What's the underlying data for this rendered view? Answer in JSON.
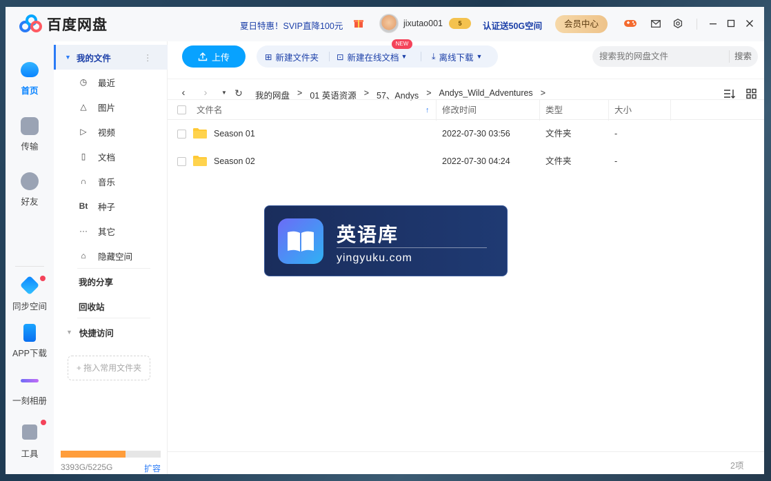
{
  "app": {
    "title": "百度网盘"
  },
  "titlebar": {
    "promo": "夏日特惠！SVIP直降100元",
    "username": "jixutao001",
    "level": "5",
    "verify": "认证送50G空间",
    "member": "会员中心"
  },
  "rail": {
    "home": "首页",
    "transfer": "传输",
    "friends": "好友",
    "sync": "同步空间",
    "app": "APP下载",
    "album": "一刻相册",
    "tools": "工具"
  },
  "sidebar": {
    "my_files": "我的文件",
    "items": [
      "最近",
      "图片",
      "视频",
      "文档",
      "音乐",
      "种子",
      "其它",
      "隐藏空间"
    ],
    "share": "我的分享",
    "recycle": "回收站",
    "quick": "快捷访问",
    "drag_hint": "+ 拖入常用文件夹",
    "quota_text": "3393G/5225G",
    "quota_fraction": 0.65,
    "expand": "扩容"
  },
  "toolbar": {
    "upload": "上传",
    "new_folder": "新建文件夹",
    "new_doc": "新建在线文档",
    "new_badge": "NEW",
    "offline": "离线下载",
    "search_placeholder": "搜索我的网盘文件",
    "search_btn": "搜索"
  },
  "breadcrumb": [
    "我的网盘",
    ">",
    "01 英语资源",
    ">",
    "57、Andys",
    ">",
    "Andys_Wild_Adventures",
    ">"
  ],
  "table": {
    "headers": {
      "name": "文件名",
      "mtime": "修改时间",
      "type": "类型",
      "size": "大小"
    },
    "rows": [
      {
        "name": "Season 01",
        "mtime": "2022-07-30 03:56",
        "type": "文件夹",
        "size": "-"
      },
      {
        "name": "Season 02",
        "mtime": "2022-07-30 04:24",
        "type": "文件夹",
        "size": "-"
      }
    ],
    "count": "2项"
  },
  "watermark": {
    "title": "英语库",
    "sub": "yingyuku.com"
  },
  "colors": {
    "accent": "#08a2ff",
    "link": "#1b3fa8",
    "quota": "#ff9d3b",
    "badge": "#f4435a"
  }
}
